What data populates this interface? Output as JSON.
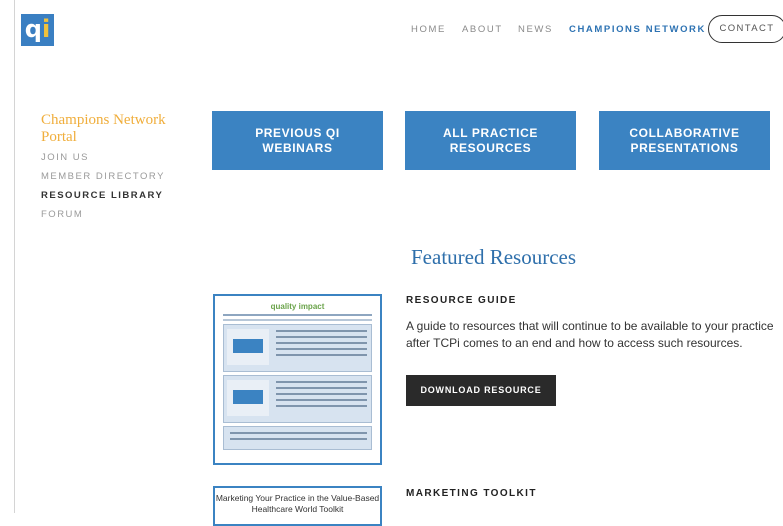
{
  "logo": {
    "text_q": "q",
    "text_i": "i"
  },
  "nav": {
    "items": [
      {
        "label": "HOME"
      },
      {
        "label": "ABOUT"
      },
      {
        "label": "NEWS"
      },
      {
        "label": "CHAMPIONS NETWORK"
      }
    ],
    "contact_label": "CONTACT"
  },
  "sidebar": {
    "title": "Champions Network Portal",
    "items": [
      {
        "label": "JOIN US"
      },
      {
        "label": "MEMBER DIRECTORY"
      },
      {
        "label": "RESOURCE LIBRARY"
      },
      {
        "label": "FORUM"
      }
    ]
  },
  "buttons": [
    {
      "label": "PREVIOUS QI WEBINARS"
    },
    {
      "label": "ALL PRACTICE RESOURCES"
    },
    {
      "label": "COLLABORATIVE PRESENTATIONS"
    }
  ],
  "featured_heading": "Featured Resources",
  "resources": [
    {
      "title": "RESOURCE GUIDE",
      "description": "A guide to resources that will continue to be available to your practice after TCPi comes to an end and how to access such resources.",
      "button_label": "DOWNLOAD RESOURCE",
      "thumb_logo": "quality impact"
    },
    {
      "title": "MARKETING TOOLKIT",
      "thumb_text": "Marketing Your Practice in the Value-Based Healthcare World Toolkit"
    }
  ],
  "colors": {
    "accent": "#3b83c2",
    "portal_title": "#f0ae3c",
    "download_button": "#2a2a2a"
  }
}
